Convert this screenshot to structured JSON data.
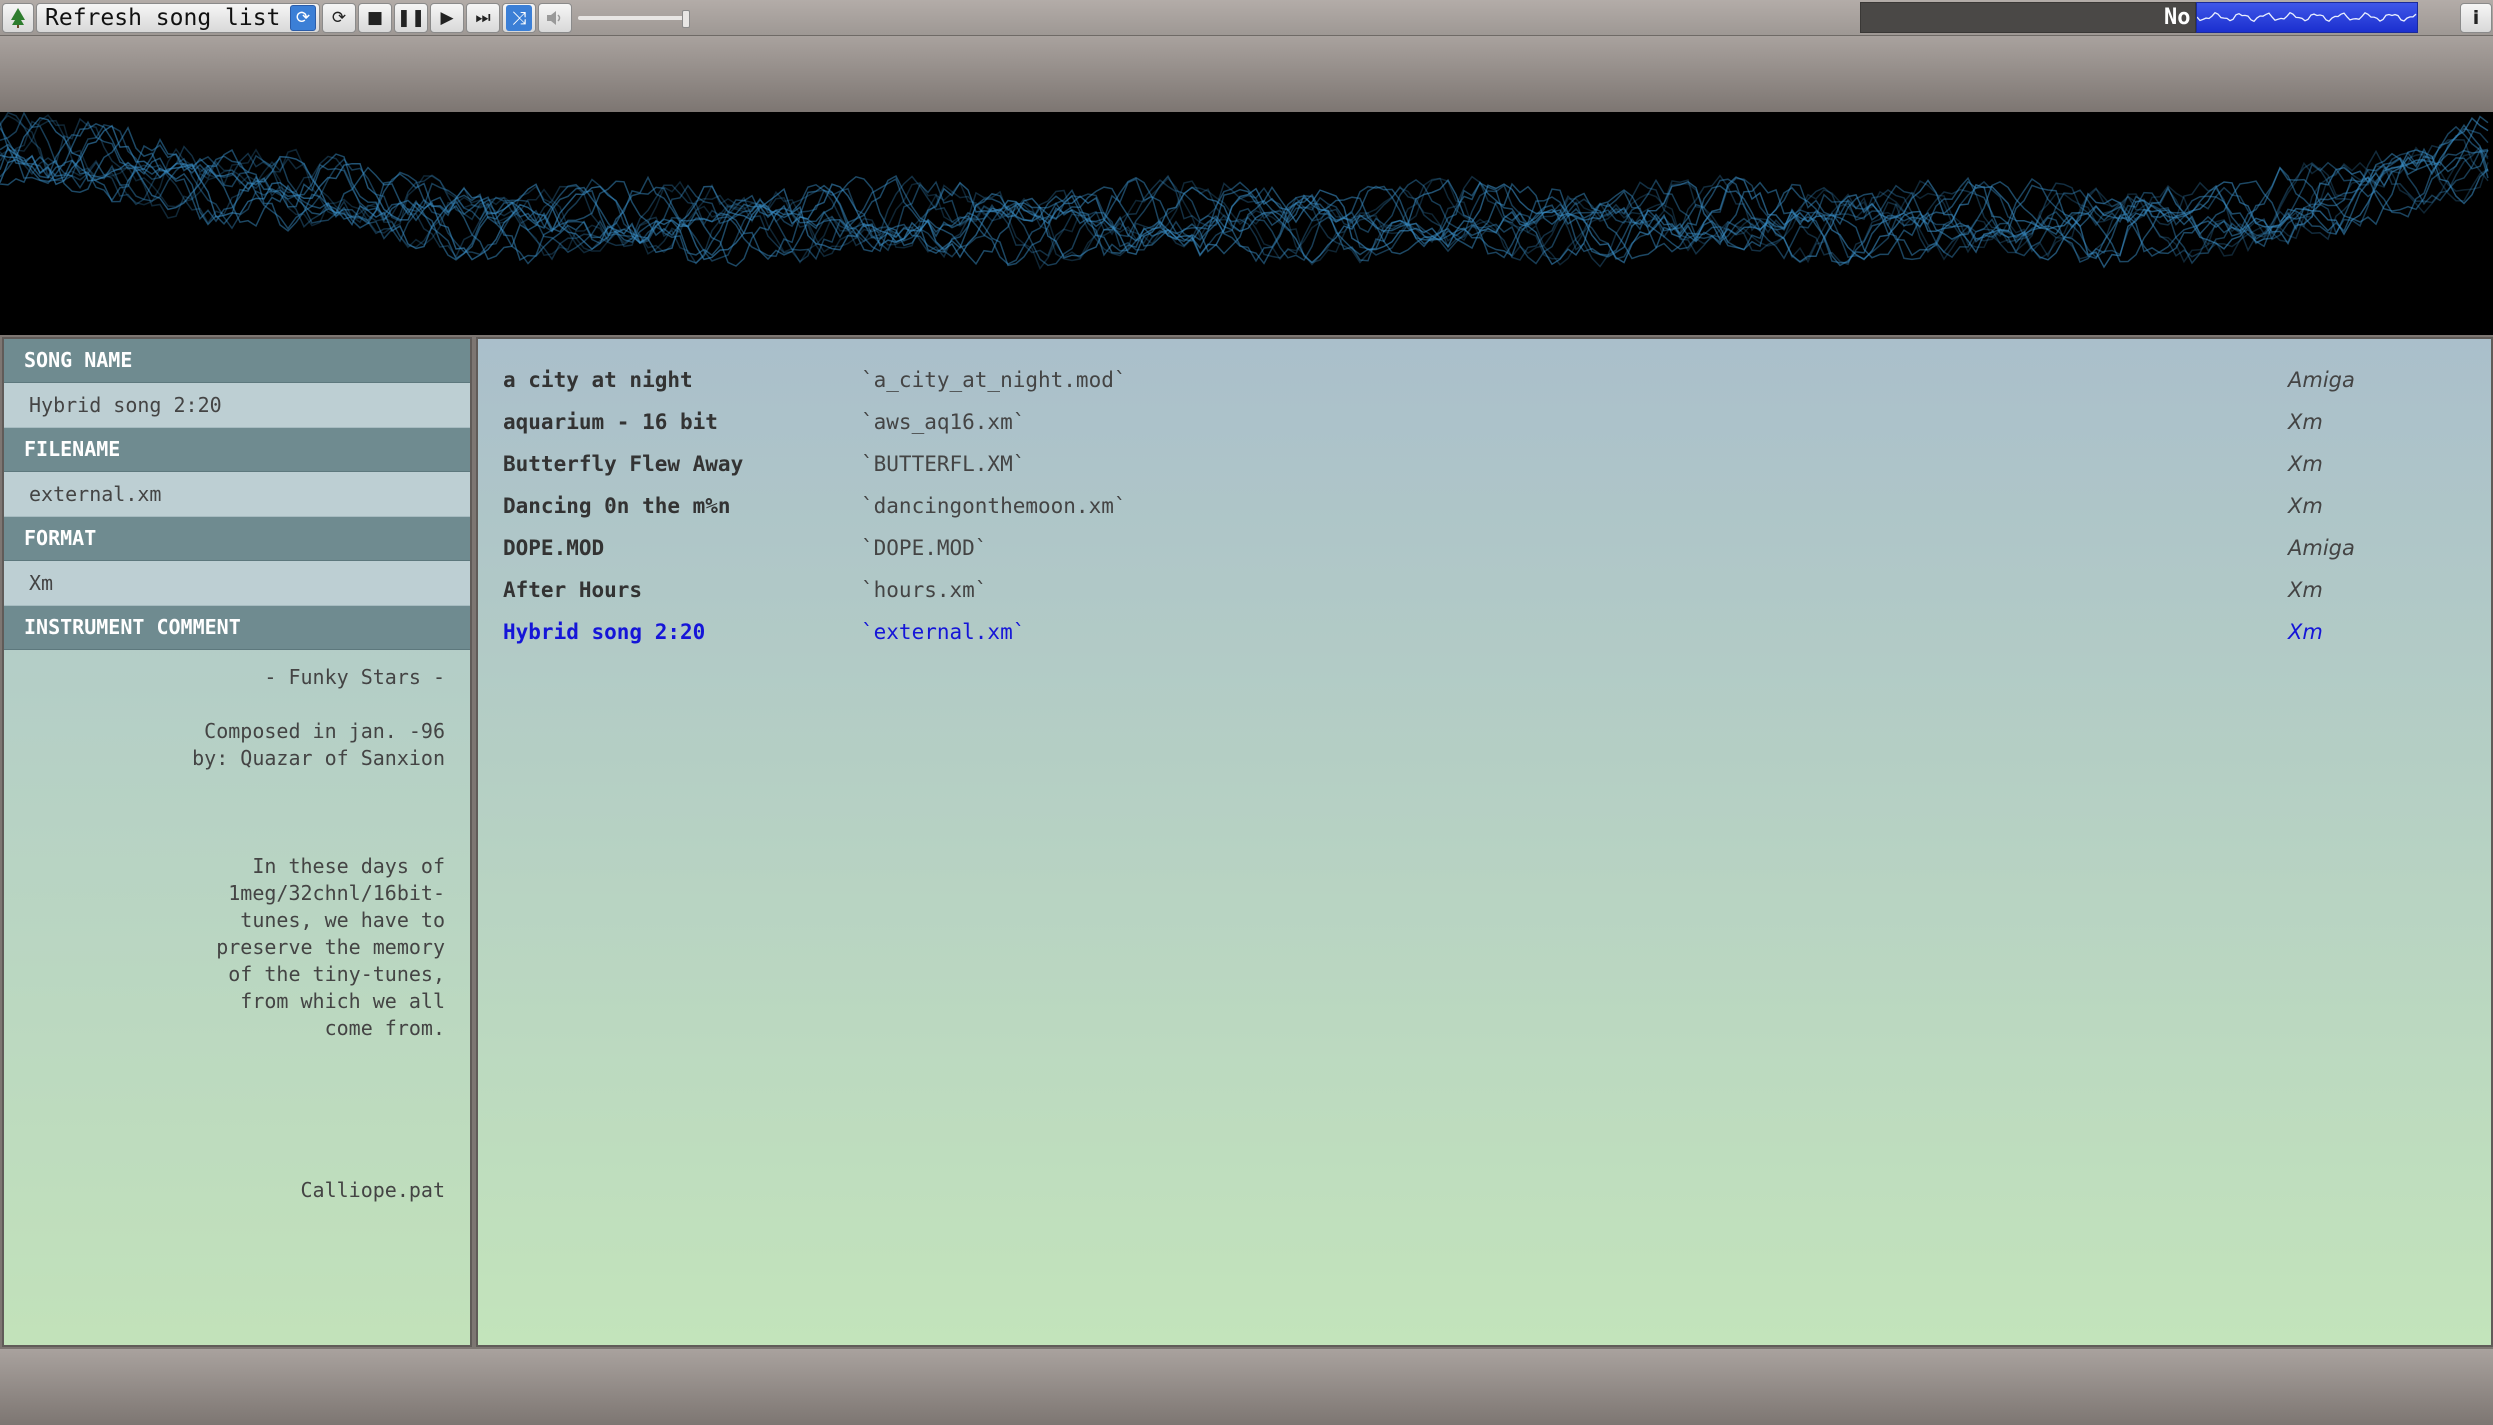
{
  "toolbar": {
    "tree_icon": "tree-icon",
    "refresh_label": "Refresh song list",
    "refresh_icon": "sync-icon",
    "reload_icon": "reload-icon",
    "stop_icon": "stop-icon",
    "pause_icon": "pause-icon",
    "play_icon": "play-icon",
    "next_icon": "skip-next-icon",
    "shuffle_icon": "shuffle-icon",
    "volume_icon": "speaker-icon",
    "volume_level": 0.93,
    "status_text": "No",
    "info_label": "i"
  },
  "info_panel": {
    "song_name_header": "SONG NAME",
    "song_name": "Hybrid song 2:20",
    "filename_header": "FILENAME",
    "filename": "external.xm",
    "format_header": "FORMAT",
    "format": "Xm",
    "comment_header": "INSTRUMENT COMMENT",
    "comment": "- Funky Stars -\n\nComposed in jan. -96\nby: Quazar of Sanxion\n\n\n\nIn these days of\n1meg/32chnl/16bit-\ntunes, we have to\npreserve the memory\nof the tiny-tunes,\nfrom which we all\ncome from.\n\n\n\n\n\nCalliope.pat"
  },
  "songs": [
    {
      "title": "a city at night",
      "file": "`a_city_at_night.mod`",
      "format": "Amiga",
      "current": false
    },
    {
      "title": "aquarium - 16 bit",
      "file": "`aws_aq16.xm`",
      "format": "Xm",
      "current": false
    },
    {
      "title": "Butterfly Flew Away",
      "file": "`BUTTERFL.XM`",
      "format": "Xm",
      "current": false
    },
    {
      "title": "Dancing 0n the m%n",
      "file": "`dancingonthemoon.xm`",
      "format": "Xm",
      "current": false
    },
    {
      "title": "DOPE.MOD",
      "file": "`DOPE.MOD`",
      "format": "Amiga",
      "current": false
    },
    {
      "title": "After Hours",
      "file": "`hours.xm`",
      "format": "Xm",
      "current": false
    },
    {
      "title": "Hybrid song 2:20",
      "file": "`external.xm`",
      "format": "Xm",
      "current": true
    }
  ],
  "colors": {
    "accent_blue": "#1515d8",
    "header_bg": "#6f8b90",
    "scope_wave": "#3a8fc8"
  }
}
